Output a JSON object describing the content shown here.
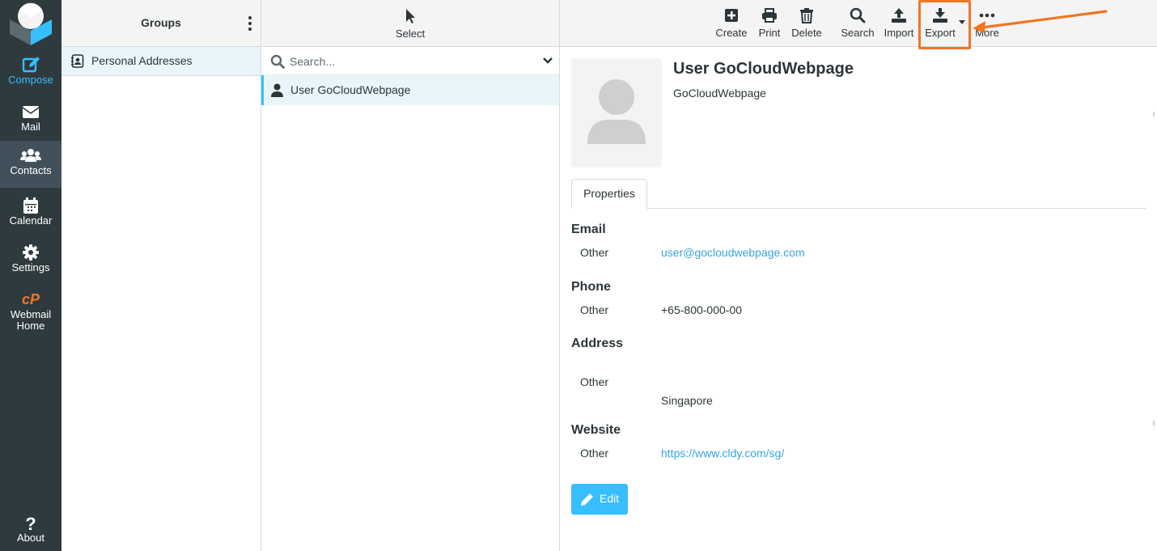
{
  "nav": {
    "items": [
      {
        "label": "Compose",
        "icon": "compose-icon"
      },
      {
        "label": "Mail",
        "icon": "mail-icon"
      },
      {
        "label": "Contacts",
        "icon": "contacts-icon"
      },
      {
        "label": "Calendar",
        "icon": "calendar-icon"
      },
      {
        "label": "Settings",
        "icon": "gear-icon"
      },
      {
        "label": "Webmail Home",
        "icon": "cpanel-icon"
      }
    ],
    "about": "About",
    "active": "Contacts"
  },
  "groups": {
    "title": "Groups",
    "items": [
      {
        "label": "Personal Addresses"
      }
    ]
  },
  "list": {
    "select_label": "Select",
    "search_placeholder": "Search...",
    "contacts": [
      {
        "name": "User GoCloudWebpage"
      }
    ]
  },
  "toolbar": {
    "buttons": [
      {
        "label": "Create",
        "icon": "plus-square-icon"
      },
      {
        "label": "Print",
        "icon": "printer-icon"
      },
      {
        "label": "Delete",
        "icon": "trash-icon"
      },
      {
        "label": "Search",
        "icon": "search-icon"
      },
      {
        "label": "Import",
        "icon": "upload-icon"
      },
      {
        "label": "Export",
        "icon": "download-icon",
        "highlighted": true
      },
      {
        "label": "More",
        "icon": "ellipsis-icon"
      }
    ]
  },
  "contact": {
    "name": "User GoCloudWebpage",
    "organization": "GoCloudWebpage",
    "tab": "Properties",
    "sections": {
      "email": {
        "title": "Email",
        "label": "Other",
        "value": "user@gocloudwebpage.com"
      },
      "phone": {
        "title": "Phone",
        "label": "Other",
        "value": "+65-800-000-00"
      },
      "address": {
        "title": "Address",
        "label": "Other",
        "value": "Singapore"
      },
      "website": {
        "title": "Website",
        "label": "Other",
        "value": "https://www.cldy.com/sg/"
      }
    },
    "edit_label": "Edit"
  },
  "colors": {
    "nav_bg": "#2f3a3f",
    "accent": "#37beff",
    "highlight": "#f07622",
    "link": "#37a4e0"
  }
}
